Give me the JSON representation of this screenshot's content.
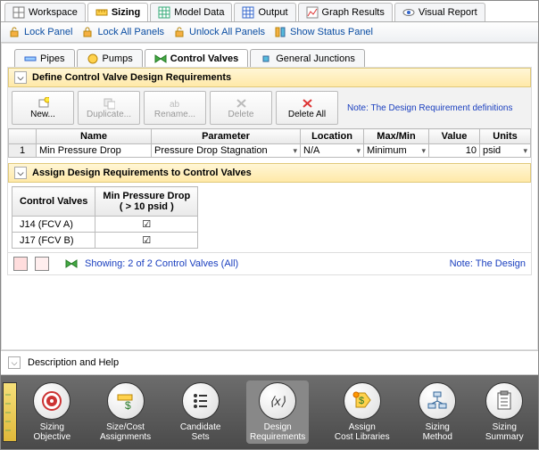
{
  "main_tabs": {
    "workspace": "Workspace",
    "sizing": "Sizing",
    "model_data": "Model Data",
    "output": "Output",
    "graph_results": "Graph Results",
    "visual_report": "Visual Report"
  },
  "lock_bar": {
    "lock_panel": "Lock Panel",
    "lock_all": "Lock All Panels",
    "unlock_all": "Unlock All Panels",
    "show_status": "Show Status Panel"
  },
  "sub_tabs": {
    "pipes": "Pipes",
    "pumps": "Pumps",
    "control_valves": "Control Valves",
    "general_junctions": "General Junctions"
  },
  "section1": {
    "title": "Define Control Valve Design Requirements",
    "buttons": {
      "new": "New...",
      "duplicate": "Duplicate...",
      "rename": "Rename...",
      "delete": "Delete",
      "delete_all": "Delete All"
    },
    "note": "Note: The Design Requirement definitions",
    "headers": {
      "row": "",
      "name": "Name",
      "parameter": "Parameter",
      "location": "Location",
      "maxmin": "Max/Min",
      "value": "Value",
      "units": "Units"
    },
    "row": {
      "num": "1",
      "name": "Min Pressure Drop",
      "parameter": "Pressure Drop Stagnation",
      "location": "N/A",
      "maxmin": "Minimum",
      "value": "10",
      "units": "psid"
    }
  },
  "section2": {
    "title": "Assign Design Requirements to Control Valves",
    "col_cv": "Control Valves",
    "col_req": "Min Pressure Drop\n( > 10 psid )",
    "rows": [
      {
        "name": "J14 (FCV A)",
        "checked": true
      },
      {
        "name": "J17 (FCV B)",
        "checked": true
      }
    ],
    "status": "Showing: 2 of 2 Control Valves (All)",
    "status_note": "Note: The Design"
  },
  "desc": "Description and Help",
  "bottom": {
    "sizing_objective": "Sizing\nObjective",
    "size_cost": "Size/Cost\nAssignments",
    "candidate": "Candidate\nSets",
    "design_req": "Design\nRequirements",
    "assign_cost": "Assign\nCost Libraries",
    "sizing_method": "Sizing\nMethod",
    "sizing_summary": "Sizing\nSummary"
  }
}
